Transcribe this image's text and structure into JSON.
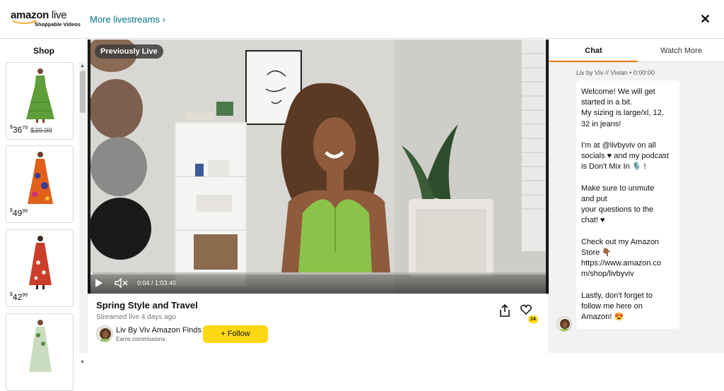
{
  "header": {
    "logo_main": "amazon",
    "logo_live": " live",
    "logo_sub": "Shoppable Videos",
    "more_livestreams": "More livestreams ›",
    "close": "✕"
  },
  "shop": {
    "title": "Shop",
    "products": [
      {
        "price_symbol": "$",
        "price_whole": "36",
        "price_fraction": "79",
        "was_price": "$39.99",
        "dress_color": "#5f9e3a"
      },
      {
        "price_symbol": "$",
        "price_whole": "49",
        "price_fraction": "99",
        "was_price": "",
        "dress_color": "#e0601c"
      },
      {
        "price_symbol": "$",
        "price_whole": "42",
        "price_fraction": "99",
        "was_price": "",
        "dress_color": "#c93d2a"
      },
      {
        "price_symbol": "",
        "price_whole": "",
        "price_fraction": "",
        "was_price": "",
        "dress_color": "#7aa36a"
      }
    ]
  },
  "video": {
    "badge": "Previously Live",
    "time": "0:04 / 1:03:40",
    "progress": 0.001
  },
  "info": {
    "title": "Spring Style and Travel",
    "streamed": "Streamed live 4 days ago",
    "channel_name": "Liv By Viv Amazon Finds",
    "channel_sub": "Earns commissions",
    "follow_label": "+ Follow",
    "likes": "14"
  },
  "chat": {
    "tab_chat": "Chat",
    "tab_watch": "Watch More",
    "meta": "Liv by Viv // Vivian • 0:00:00",
    "messages": [
      "Welcome! We will get\nstarted in a bit.\nMy sizing is large/xl, 12,\n32 in jeans!",
      "I'm at @livbyviv on all\nsocials ♥ and my podcast\nis Don't Mix In 🎙️ !",
      "Make sure to unmute\nand put\nyour questions to the\nchat! ♥",
      "Check out my Amazon\nStore 👇🏾\nhttps://www.amazon.co\nm/shop/livbyviv",
      "Lastly, don't forget to\nfollow me here on\nAmazon! 😍"
    ]
  },
  "colors": {
    "accent": "#e77600",
    "follow": "#ffd814",
    "link": "#007185"
  }
}
